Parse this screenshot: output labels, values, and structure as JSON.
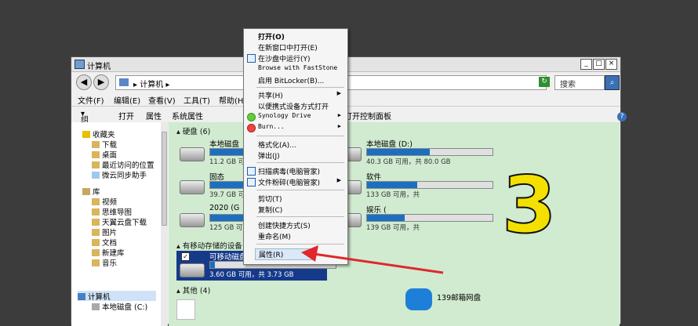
{
  "window": {
    "title": "计算机"
  },
  "address": {
    "path": "计算机",
    "search_placeholder": "搜索"
  },
  "menubar": [
    "文件(F)",
    "编辑(E)",
    "查看(V)",
    "工具(T)",
    "帮助(H)"
  ],
  "toolbar": [
    "组织",
    "打开",
    "属性",
    "系统属性",
    "打开控制面板"
  ],
  "sidebar": [
    {
      "label": "收藏夹",
      "icon": "star-icon"
    },
    {
      "label": "下载",
      "icon": "folder-icon"
    },
    {
      "label": "桌面",
      "icon": "folder-icon"
    },
    {
      "label": "最近访问的位置",
      "icon": "folder-icon"
    },
    {
      "label": "微云同步助手",
      "icon": "cloud-icon"
    },
    {
      "label": "库",
      "icon": "library-icon"
    },
    {
      "label": "视频",
      "icon": "folder-icon"
    },
    {
      "label": "思维导图",
      "icon": "folder-icon"
    },
    {
      "label": "天翼云盘下载",
      "icon": "folder-icon"
    },
    {
      "label": "图片",
      "icon": "folder-icon"
    },
    {
      "label": "文档",
      "icon": "folder-icon"
    },
    {
      "label": "新建库",
      "icon": "folder-icon"
    },
    {
      "label": "音乐",
      "icon": "folder-icon"
    },
    {
      "label": "计算机",
      "icon": "computer-icon"
    },
    {
      "label": "本地磁盘 (C:)",
      "icon": "drive-icon"
    }
  ],
  "groups": {
    "hard_disks": "硬盘 (6)",
    "removable": "有移动存储的设备",
    "other": "其他 (4)"
  },
  "drives": [
    {
      "name": "本地磁盘",
      "info": "11.2 GB 可",
      "fill": 0.32
    },
    {
      "name": "本地磁盘 (D:)",
      "info": "40.3 GB 可用，共 80.0 GB",
      "fill": 0.5
    },
    {
      "name": "固态",
      "info": "39.7 GB 可",
      "fill": 0.45
    },
    {
      "name": "软件",
      "info": "133 GB 可用，共 ",
      "fill": 0.4
    },
    {
      "name": "2020 (G",
      "info": "125 GB 可",
      "fill": 0.35
    },
    {
      "name": "娱乐 (",
      "info": "139 GB 可用，共 ",
      "fill": 0.3
    },
    {
      "name": "可移动磁盘",
      "info": "3.60 GB 可用，共 3.73 GB",
      "fill": 0.04
    }
  ],
  "other_items": [
    {
      "name": "139邮箱网盘"
    }
  ],
  "context_menu": [
    "打开(O)",
    "在新窗口中打开(E)",
    "在沙盘中运行(Y)",
    "Browse with FastStone",
    "启用 BitLocker(B)...",
    "共享(H)",
    "以便携式设备方式打开",
    "Synology Drive",
    "Burn...",
    "格式化(A)...",
    "弹出(J)",
    "扫描病毒(电脑管家)",
    "文件粉碎(电脑管家)",
    "剪切(T)",
    "复制(C)",
    "创建快捷方式(S)",
    "重命名(M)",
    "属性(R)"
  ],
  "annotation": {
    "number": "3",
    "arrow_color": "#e0282c",
    "number_color": "#f3e000"
  }
}
